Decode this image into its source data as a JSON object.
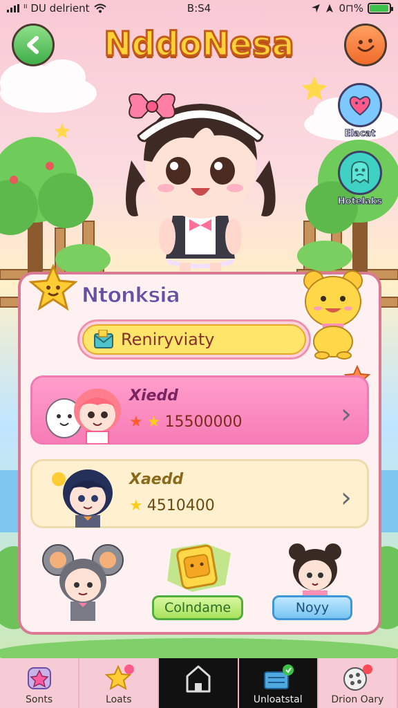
{
  "status_bar": {
    "carrier": "ᴵᴵ DU delrient",
    "time": "B:S4",
    "battery_text": "0⊓%",
    "battery_level": 0.95
  },
  "header": {
    "title": "NddoNesa"
  },
  "side_buttons": [
    {
      "label": "Elacat",
      "icon": "heart-face-icon",
      "color": "#ff5a8a"
    },
    {
      "label": "Hotelaks",
      "icon": "ghost-icon",
      "color": "#3fd1c4"
    }
  ],
  "card": {
    "title": "Ntonksia",
    "search": {
      "value": "Reniryviaty"
    },
    "rows": [
      {
        "name": "Xiedd",
        "score": "15500000"
      },
      {
        "name": "Xaedd",
        "score": "4510400"
      }
    ],
    "buttons": {
      "green": "Colndame",
      "blue": "Noyy"
    }
  },
  "nav": {
    "items": [
      {
        "label": "Sonts",
        "icon": "star-badge-icon"
      },
      {
        "label": "Loats",
        "icon": "shooting-star-icon"
      },
      {
        "label": "",
        "icon": "home-icon"
      },
      {
        "label": "Unloatstal",
        "icon": "inbox-icon"
      },
      {
        "label": "Drion Oary",
        "icon": "gamepad-icon"
      }
    ]
  },
  "colors": {
    "accent_pink": "#f77cb7",
    "title_yellow": "#ffd338",
    "card_border": "#d97a92"
  }
}
